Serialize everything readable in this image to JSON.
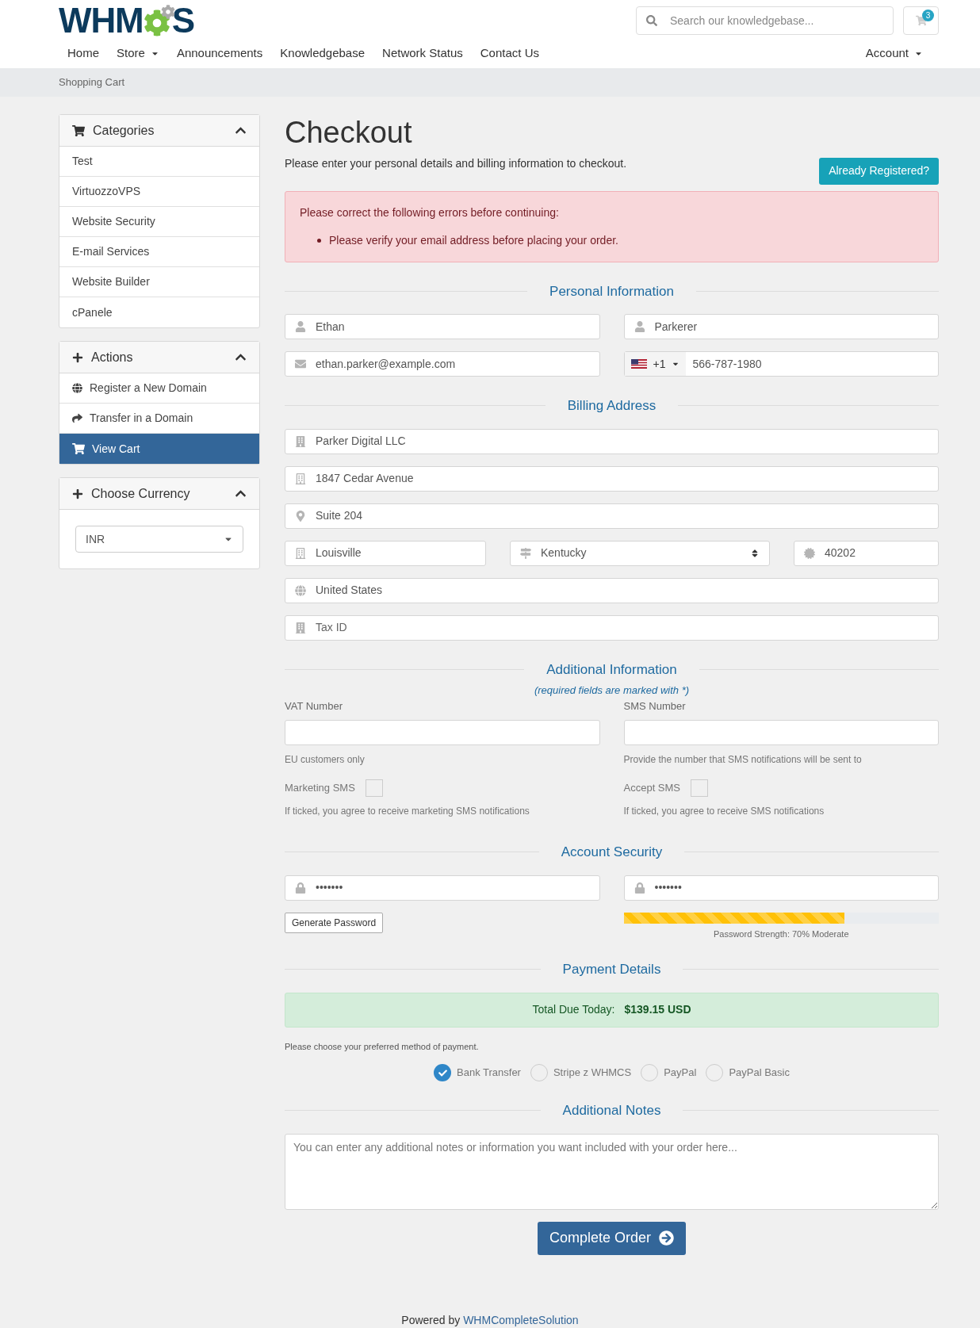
{
  "header": {
    "logo": {
      "before": "WHM",
      "after": "S"
    },
    "search": {
      "placeholder": "Search our knowledgebase..."
    },
    "cart_badge": "3"
  },
  "nav": {
    "items": [
      {
        "label": "Home",
        "dropdown": false
      },
      {
        "label": "Store",
        "dropdown": true
      },
      {
        "label": "Announcements",
        "dropdown": false
      },
      {
        "label": "Knowledgebase",
        "dropdown": false
      },
      {
        "label": "Network Status",
        "dropdown": false
      },
      {
        "label": "Contact Us",
        "dropdown": false
      }
    ],
    "account": {
      "label": "Account",
      "dropdown": true
    }
  },
  "breadcrumb": "Shopping Cart",
  "sidebar": {
    "panels": [
      {
        "title": "Categories",
        "kind": "cart",
        "expanded": true,
        "items": [
          {
            "label": "Test",
            "selected": false
          },
          {
            "label": "VirtuozzoVPS",
            "selected": false
          },
          {
            "label": "Website Security",
            "selected": false
          },
          {
            "label": "E-mail Services",
            "selected": false
          },
          {
            "label": "Website Builder",
            "selected": false
          },
          {
            "label": "cPanele",
            "selected": false
          }
        ]
      },
      {
        "title": "Actions",
        "kind": "plus",
        "expanded": true,
        "items": [
          {
            "label": "Register a New Domain",
            "selected": false
          },
          {
            "label": "Transfer in a Domain",
            "selected": false
          },
          {
            "label": "View Cart",
            "selected": true
          }
        ]
      },
      {
        "title": "Choose Currency",
        "kind": "plus",
        "expanded": true,
        "select": "INR"
      }
    ]
  },
  "checkout": {
    "title": "Checkout",
    "subtitle": "Please enter your personal details and billing information to checkout.",
    "already_registered": "Already Registered?",
    "errors": {
      "heading": "Please correct the following errors before continuing:",
      "items": [
        "Please verify your email address before placing your order."
      ]
    },
    "personal": {
      "title": "Personal Information",
      "first_name": {
        "value": "Ethan"
      },
      "last_name": {
        "value": "Parkerer"
      },
      "email": {
        "value": "ethan.parker@example.com"
      },
      "phone": {
        "country_code": "+1",
        "value": "566-787-1980"
      }
    },
    "billing": {
      "title": "Billing Address",
      "company": {
        "value": "Parker Digital LLC"
      },
      "address1": {
        "value": "1847 Cedar Avenue"
      },
      "address2": {
        "value": "Suite 204"
      },
      "city": {
        "value": "Louisville"
      },
      "state": {
        "value": "Kentucky"
      },
      "postcode": {
        "value": "40202"
      },
      "country": {
        "value": "United States"
      },
      "tax_id": {
        "placeholder": "Tax ID"
      }
    },
    "additional": {
      "title": "Additional Information",
      "note": "(required fields are marked with *)",
      "columns": [
        {
          "label": "VAT Number",
          "help": "EU customers only",
          "checkbox": {
            "label": "Marketing SMS",
            "checked": false
          },
          "checkbox_help": "If ticked, you agree to receive marketing SMS notifications"
        },
        {
          "label": "SMS Number",
          "help": "Provide the number that SMS notifications will be sent to",
          "checkbox": {
            "label": "Accept SMS",
            "checked": false
          },
          "checkbox_help": "If ticked, you agree to receive SMS notifications"
        }
      ]
    },
    "security": {
      "title": "Account Security",
      "password": {
        "value": "•••••••"
      },
      "confirm": {
        "value": "•••••••"
      },
      "generate": "Generate Password",
      "strength": {
        "level": 0.7,
        "label": "Password Strength: 70% Moderate"
      }
    },
    "payment": {
      "title": "Payment Details",
      "total_label": "Total Due Today:",
      "total": "$139.15 USD",
      "prompt": "Please choose your preferred method of payment.",
      "methods": [
        {
          "label": "Bank Transfer",
          "selected": true
        },
        {
          "label": "Stripe z WHMCS",
          "selected": false
        },
        {
          "label": "PayPal",
          "selected": false
        },
        {
          "label": "PayPal Basic",
          "selected": false
        }
      ]
    },
    "notes": {
      "title": "Additional Notes",
      "placeholder": "You can enter any additional notes or information you want included with your order here..."
    },
    "complete": "Complete Order"
  },
  "footer": {
    "prefix": "Powered by",
    "link": "WHMCompleteSolution"
  }
}
